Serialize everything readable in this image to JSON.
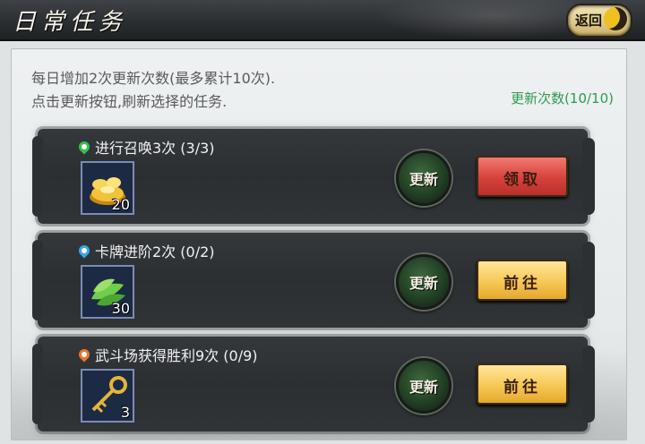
{
  "header": {
    "title": "日常任务",
    "back_label": "返回"
  },
  "panel": {
    "desc_line1": "每日增加2次更新次数(最多累计10次).",
    "desc_line2": "点击更新按钮,刷新选择的任务.",
    "refresh_count": "更新次数(10/10)"
  },
  "tasks": [
    {
      "title": "进行召唤3次 (3/3)",
      "pin_color": "#33c24a",
      "reward_icon": "gold-ingot-icon",
      "reward_count": "20",
      "refresh_label": "更新",
      "action_label": "领取",
      "action_type": "claim"
    },
    {
      "title": "卡牌进阶2次 (0/2)",
      "pin_color": "#3aa6e8",
      "reward_icon": "green-leaf-icon",
      "reward_count": "30",
      "refresh_label": "更新",
      "action_label": "前往",
      "action_type": "go"
    },
    {
      "title": "武斗场获得胜利9次 (0/9)",
      "pin_color": "#e8762a",
      "reward_icon": "golden-key-icon",
      "reward_count": "3",
      "refresh_label": "更新",
      "action_label": "前往",
      "action_type": "go"
    }
  ]
}
